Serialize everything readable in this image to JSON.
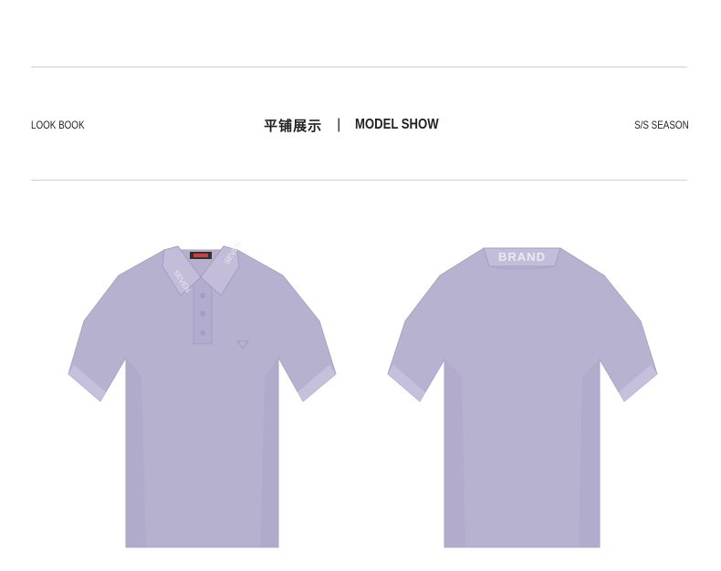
{
  "header": {
    "left_label": "LOOK BOOK",
    "center_cn": "平铺展示",
    "center_sep": "|",
    "center_en": "MODEL SHOW",
    "right_label": "S/S SEASON"
  },
  "product": {
    "color": "#b9b3d2",
    "collar_text_front": "SEVEN",
    "collar_text_back": "BRAND",
    "label_text": "SEVEN"
  }
}
